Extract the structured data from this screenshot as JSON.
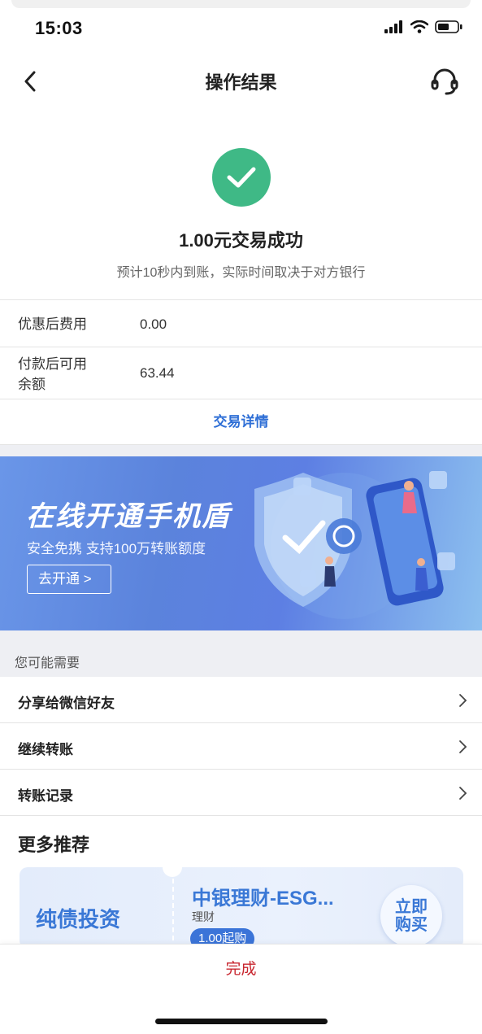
{
  "status_bar": {
    "time": "15:03"
  },
  "nav": {
    "title": "操作结果",
    "back_icon": "chevron-left-icon",
    "service_icon": "headset-icon"
  },
  "result": {
    "title": "1.00元交易成功",
    "subtitle": "预计10秒内到账，实际时间取决于对方银行",
    "icon": "check-icon",
    "accent": "#3fb986"
  },
  "info": [
    {
      "label": "优惠后费用",
      "value": "0.00"
    },
    {
      "label": "付款后可用余额",
      "value": "63.44"
    }
  ],
  "detail_link": "交易详情",
  "banner": {
    "title": "在线开通手机盾",
    "subtitle": "安全免携 支持100万转账额度",
    "button": "去开通 >"
  },
  "need": {
    "header": "您可能需要",
    "items": [
      {
        "label": "分享给微信好友"
      },
      {
        "label": "继续转账"
      },
      {
        "label": "转账记录"
      }
    ]
  },
  "more": {
    "title": "更多推荐",
    "card": {
      "category": "纯债投资",
      "name": "中银理财-ESG...",
      "type": "理财",
      "tag": "1.00起购",
      "buy": "立即购买"
    }
  },
  "bottom": {
    "done": "完成",
    "done_color": "#c8262f"
  }
}
